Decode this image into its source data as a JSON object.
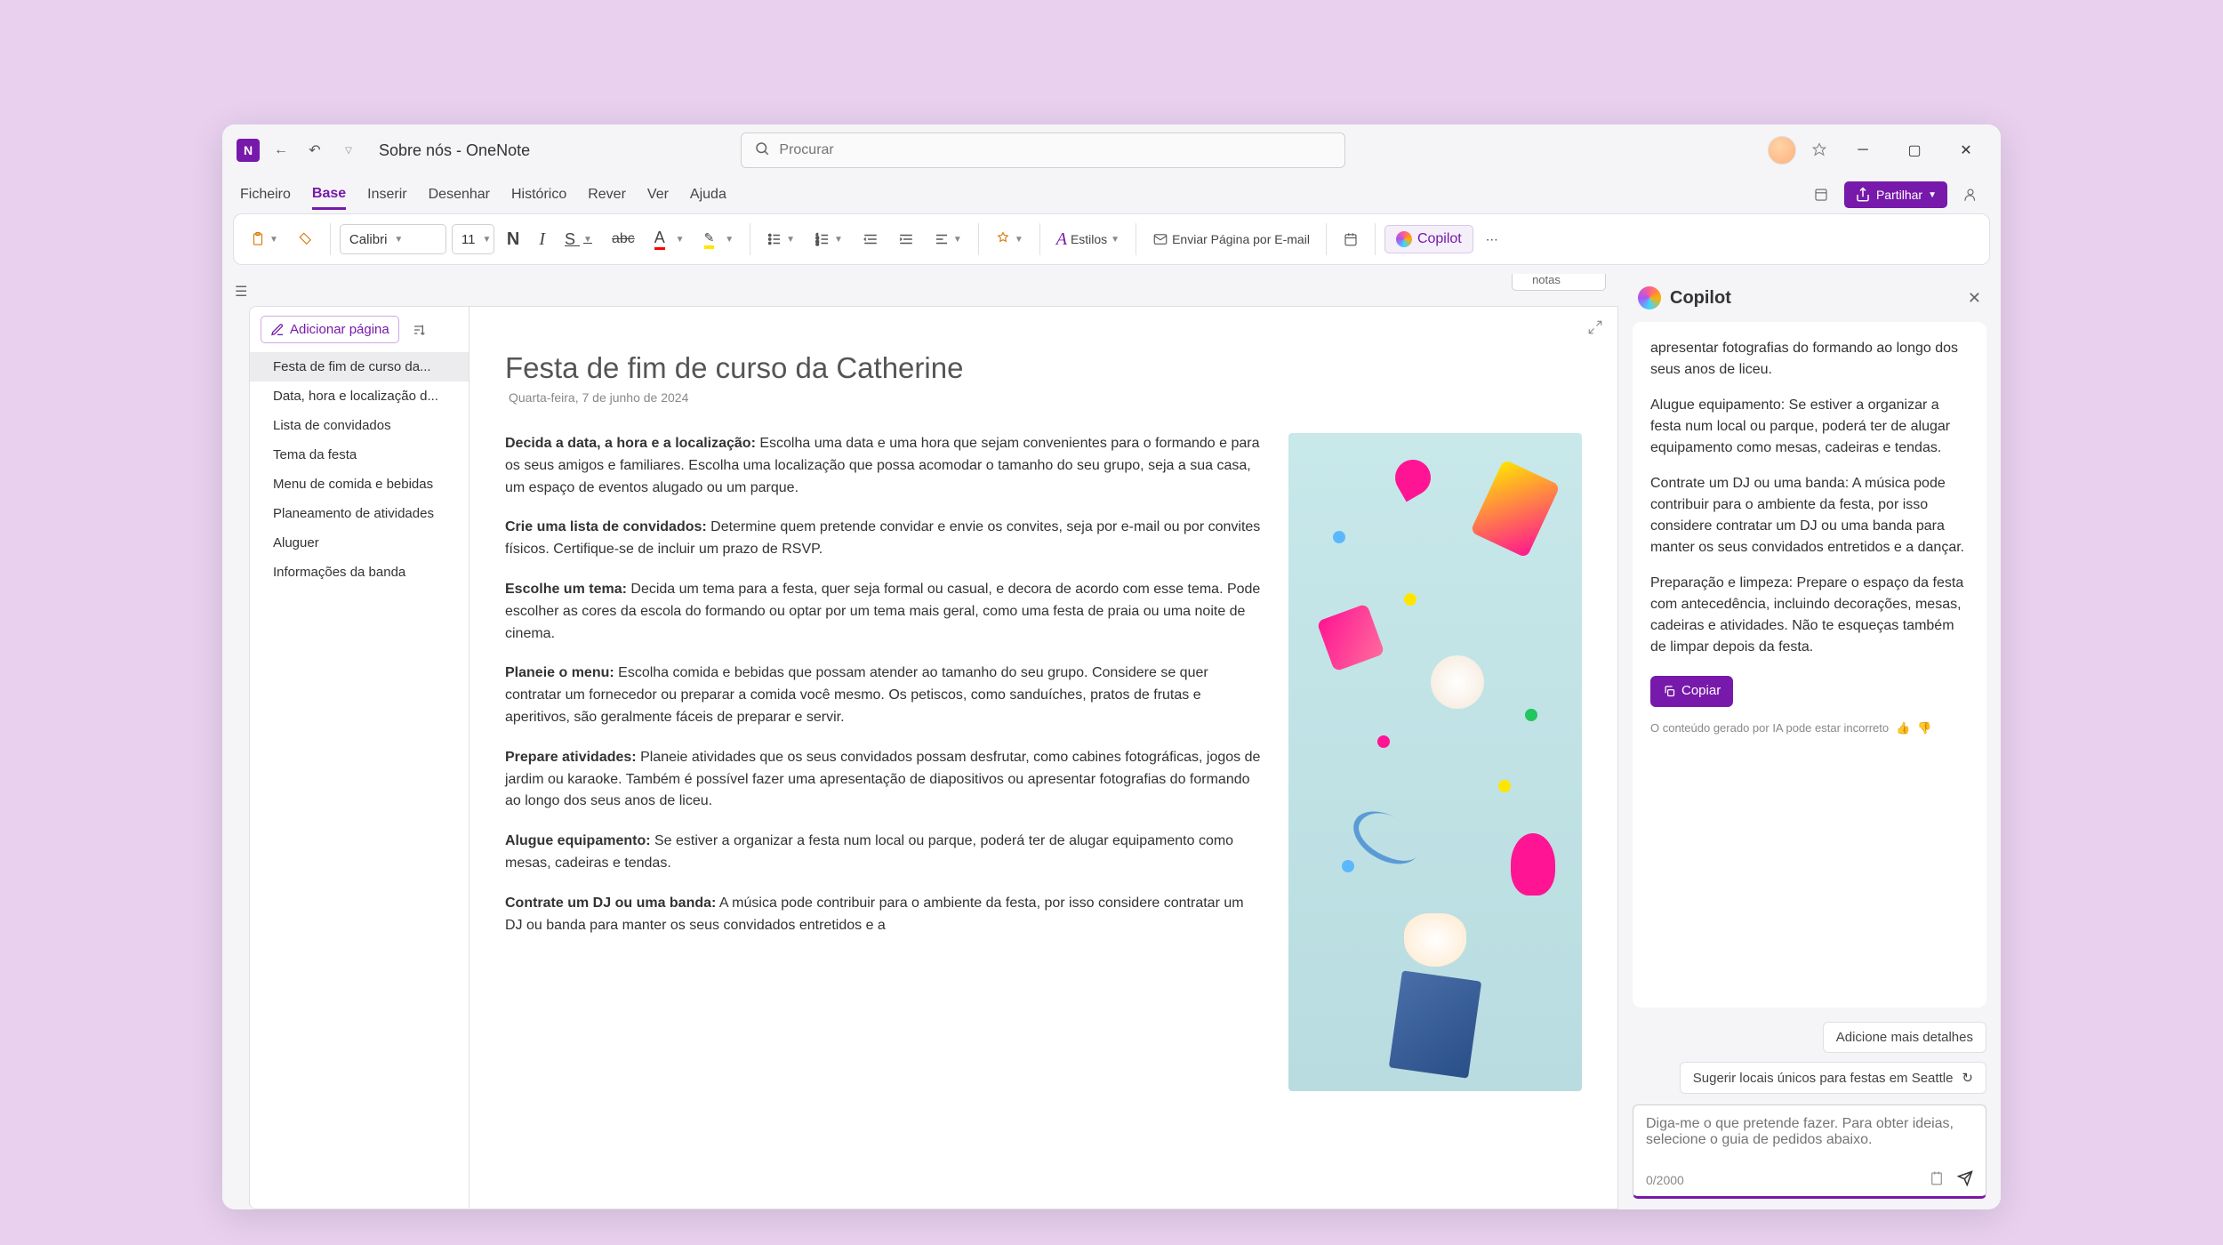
{
  "window": {
    "title": "Sobre nós - OneNote"
  },
  "search": {
    "placeholder": "Procurar"
  },
  "menu": {
    "items": [
      "Ficheiro",
      "Base",
      "Inserir",
      "Desenhar",
      "Histórico",
      "Rever",
      "Ver",
      "Ajuda"
    ],
    "active_index": 1,
    "share": "Partilhar"
  },
  "ribbon": {
    "font_name": "Calibri",
    "font_size": "11",
    "styles": "Estilos",
    "email": "Enviar Página por E-mail",
    "copilot": "Copilot"
  },
  "notebook_search": "Procurar blocos de notas",
  "page_panel": {
    "add": "Adicionar página",
    "items": [
      "Festa de fim de curso da...",
      "Data, hora e localização d...",
      "Lista de convidados",
      "Tema da festa",
      "Menu de comida e bebidas",
      "Planeamento de atividades",
      "Aluguer",
      "Informações da banda"
    ],
    "active_index": 0
  },
  "doc": {
    "title": "Festa de fim de curso da Catherine",
    "date": "Quarta-feira, 7 de junho de 2024",
    "sections": [
      {
        "h": "Decida a data, a hora e a localização:",
        "b": " Escolha uma data e uma hora que sejam convenientes para o formando e para os seus amigos e familiares. Escolha uma localização que possa acomodar o tamanho do seu grupo, seja a sua casa, um espaço de eventos alugado ou um parque."
      },
      {
        "h": "Crie uma lista de convidados:",
        "b": " Determine quem pretende convidar e envie os convites, seja por e-mail ou por convites físicos. Certifique-se de incluir um prazo de RSVP."
      },
      {
        "h": "Escolhe um tema:",
        "b": " Decida um tema para a festa, quer seja formal ou casual, e decora de acordo com esse tema. Pode escolher as cores da escola do formando ou optar por um tema mais geral, como uma festa de praia ou uma noite de cinema."
      },
      {
        "h": "Planeie o menu:",
        "b": " Escolha comida e bebidas que possam atender ao tamanho do seu grupo. Considere se quer contratar um fornecedor ou preparar a comida você mesmo. Os petiscos, como sanduíches, pratos de frutas e aperitivos, são geralmente fáceis de preparar e servir."
      },
      {
        "h": "Prepare atividades:",
        "b": " Planeie atividades que os seus convidados possam desfrutar, como cabines fotográficas, jogos de jardim ou karaoke. Também é possível fazer uma apresentação de diapositivos ou apresentar fotografias do formando ao longo dos seus anos de liceu."
      },
      {
        "h": "Alugue equipamento:",
        "b": " Se estiver a organizar a festa num local ou parque, poderá ter de alugar equipamento como mesas, cadeiras e tendas."
      },
      {
        "h": "Contrate um DJ ou uma banda:",
        "b": " A música pode contribuir para o ambiente da festa, por isso considere contratar um DJ ou banda para manter os seus convidados entretidos e a"
      }
    ]
  },
  "copilot": {
    "title": "Copilot",
    "msg": [
      "apresentar fotografias do formando ao longo dos seus anos de liceu.",
      "Alugue equipamento: Se estiver a organizar a festa num local ou parque, poderá ter de alugar equipamento como mesas, cadeiras e tendas.",
      "Contrate um DJ ou uma banda: A música pode contribuir para o ambiente da festa, por isso considere contratar um DJ ou uma banda para manter os seus convidados entretidos e a dançar.",
      "Preparação e limpeza: Prepare o espaço da festa com antecedência, incluindo decorações, mesas, cadeiras e atividades. Não te esqueças também de limpar depois da festa."
    ],
    "copy": "Copiar",
    "disclaimer": "O conteúdo gerado por IA pode estar incorreto",
    "suggestions": [
      "Adicione mais detalhes",
      "Sugerir locais únicos para festas em Seattle"
    ],
    "input_placeholder": "Diga-me o que pretende fazer. Para obter ideias, selecione o guia de pedidos abaixo.",
    "counter": "0/2000"
  }
}
